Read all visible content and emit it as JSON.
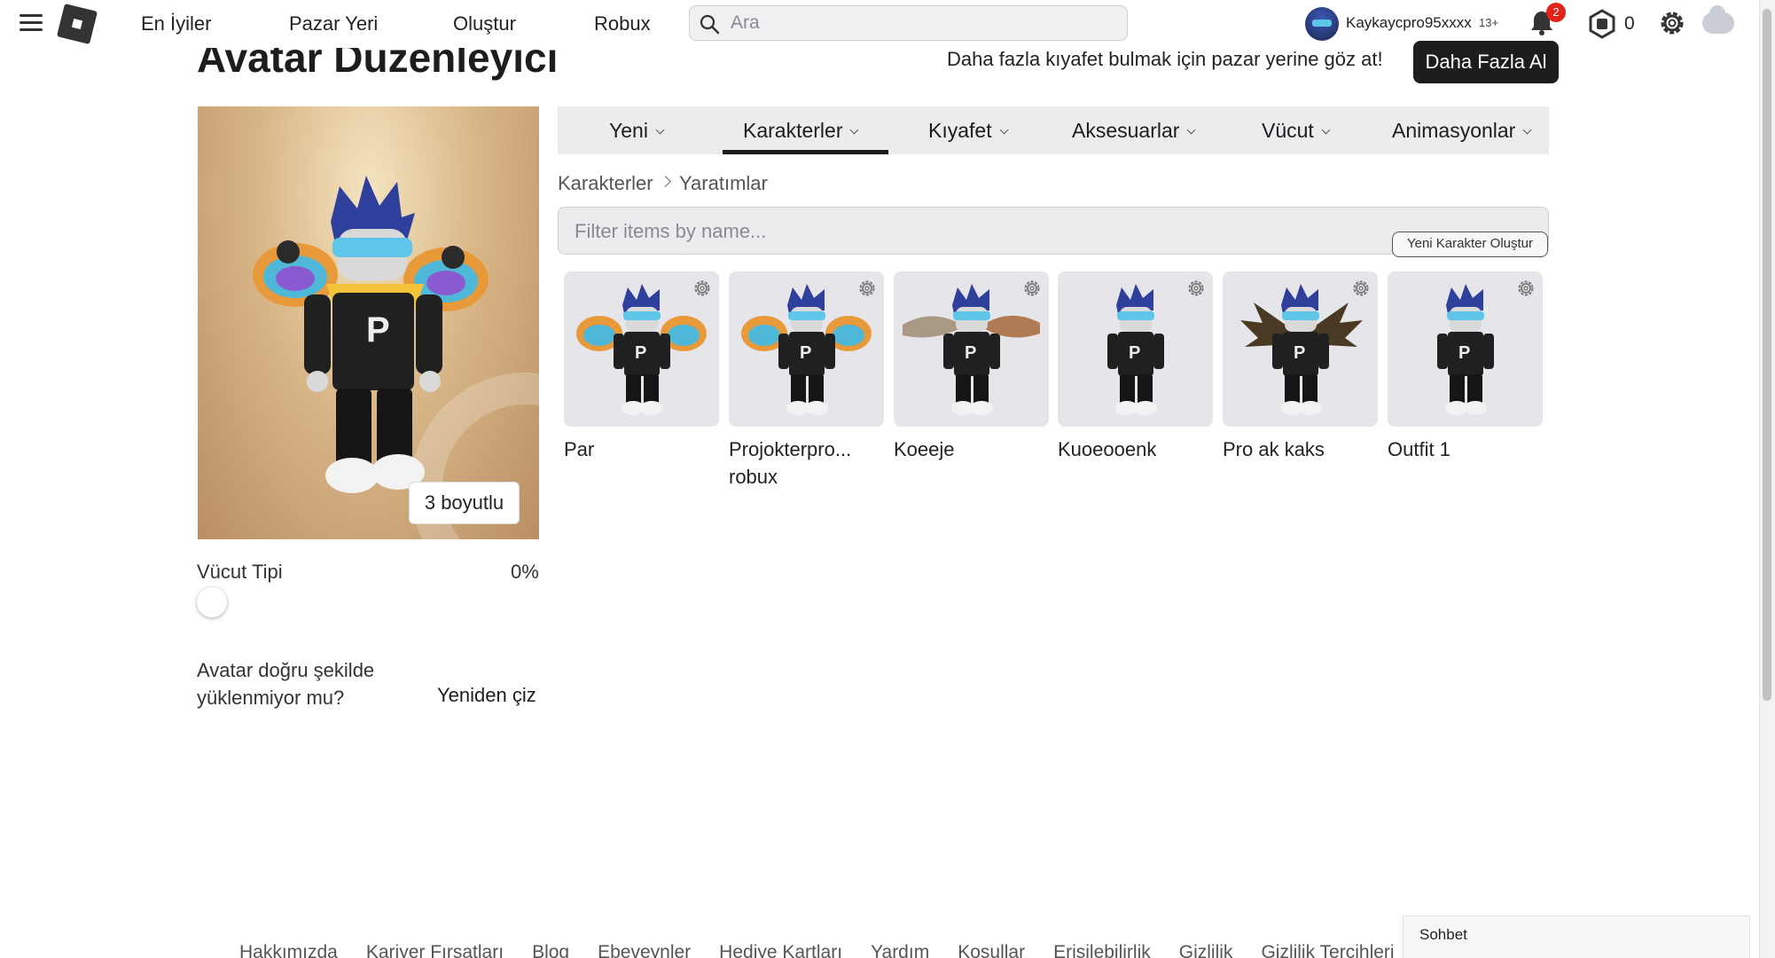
{
  "nav": {
    "links": [
      "En İyiler",
      "Pazar Yeri",
      "Oluştur",
      "Robux"
    ],
    "search_placeholder": "Ara",
    "username": "Kaykaycpro95xxxx",
    "age_label": "13+",
    "notification_count": "2",
    "robux_count": "0"
  },
  "header": {
    "title": "Avatar Düzenleyici",
    "promo": "Daha fazla kıyafet bulmak için pazar yerine göz at!",
    "get_more_label": "Daha Fazla Al"
  },
  "preview": {
    "view_toggle": "3 boyutlu",
    "body_type_label": "Vücut Tipi",
    "body_type_value": "0%",
    "body_type_fraction": 0.0,
    "redraw_question": "Avatar doğru şekilde yüklenmiyor mu?",
    "redraw_link": "Yeniden çiz"
  },
  "tabs": [
    {
      "label": "Yeni",
      "active": false
    },
    {
      "label": "Karakterler",
      "active": true
    },
    {
      "label": "Kıyafet",
      "active": false
    },
    {
      "label": "Aksesuarlar",
      "active": false
    },
    {
      "label": "Vücut",
      "active": false
    },
    {
      "label": "Animasyonlar",
      "active": false
    }
  ],
  "breadcrumb": [
    "Karakterler",
    "Yaratımlar"
  ],
  "filter_placeholder": "Filter items by name...",
  "new_character_label": "Yeni Karakter Oluştur",
  "outfits": [
    {
      "name_line1": "Par",
      "name_line2": "",
      "figure": "rainbow-wings"
    },
    {
      "name_line1": "Projokterpro...",
      "name_line2": "robux",
      "figure": "rainbow-wings"
    },
    {
      "name_line1": "Koeeje",
      "name_line2": "",
      "figure": "feather-wings"
    },
    {
      "name_line1": "Kuoeooenk",
      "name_line2": "",
      "figure": "plain"
    },
    {
      "name_line1": "Pro ak kaks",
      "name_line2": "",
      "figure": "bat-wings"
    },
    {
      "name_line1": "Outfit 1",
      "name_line2": "",
      "figure": "plain"
    }
  ],
  "footer": {
    "links": [
      "Hakkımızda",
      "Kariyer Fırsatları",
      "Blog",
      "Ebeveynler",
      "Hediye Kartları",
      "Yardım",
      "Koşullar",
      "Erişilebilirlik",
      "Gizlilik",
      "Gizlilik Tercihleri"
    ]
  },
  "chat_label": "Sohbet",
  "colors": {
    "accent_dark": "#1d1d1f",
    "tab_bg": "#ececef",
    "badge_red": "#e2231a",
    "hair_blue": "#2f3f9c",
    "goggles": "#5ec6e8"
  }
}
